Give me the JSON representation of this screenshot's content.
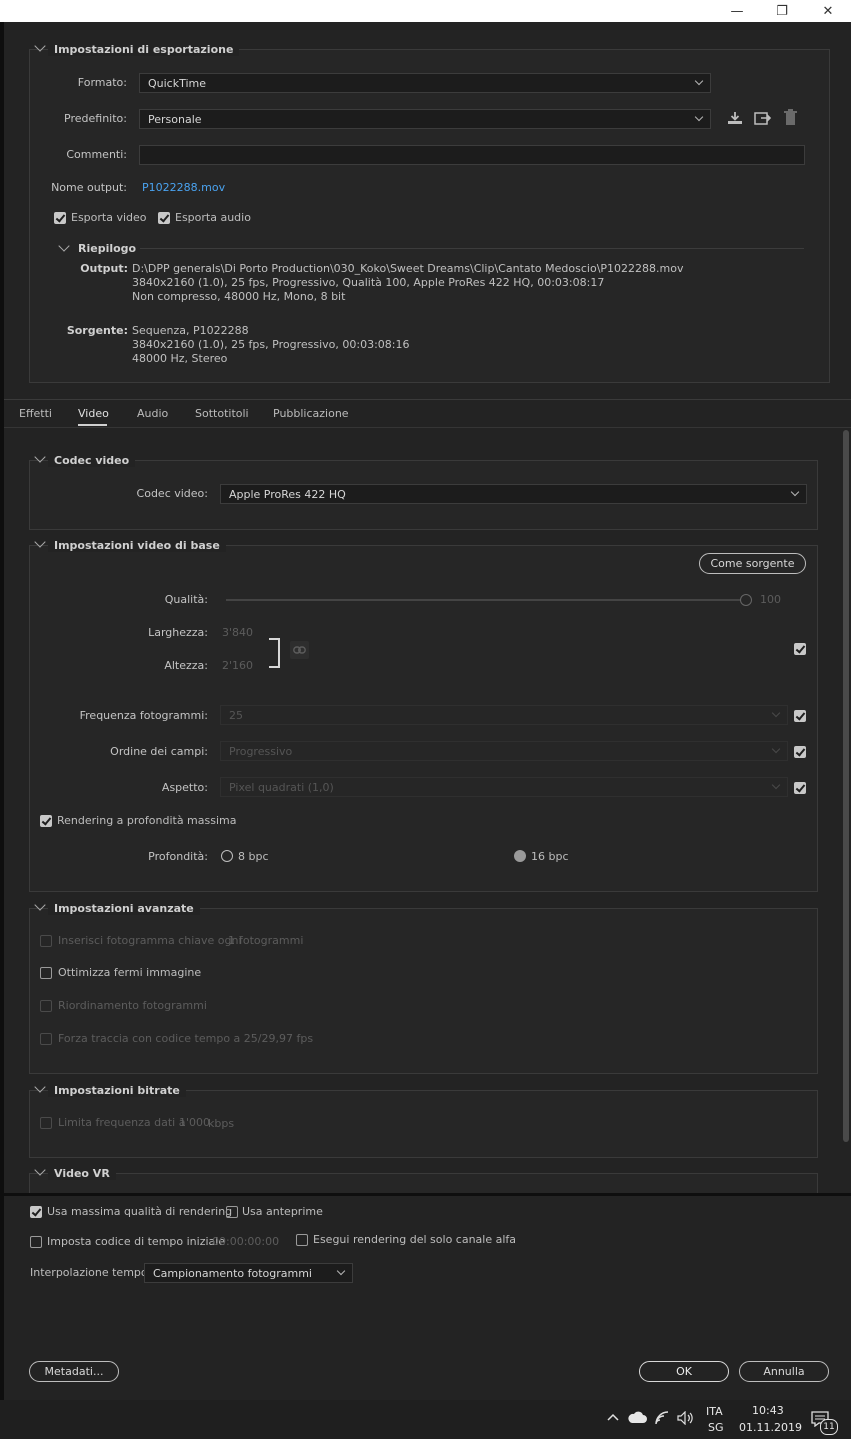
{
  "window": {
    "minimize": "—",
    "restore": "❐",
    "close": "✕"
  },
  "export_settings": {
    "title": "Impostazioni di esportazione",
    "format_label": "Formato:",
    "format_value": "QuickTime",
    "preset_label": "Predefinito:",
    "preset_value": "Personale",
    "comments_label": "Commenti:",
    "comments_value": "",
    "output_name_label": "Nome output:",
    "output_name_value": "P1022288.mov",
    "export_video_label": "Esporta video",
    "export_audio_label": "Esporta audio",
    "summary_title": "Riepilogo",
    "output_label": "Output:",
    "output_lines": [
      "D:\\DPP generals\\Di Porto Production\\030_Koko\\Sweet Dreams\\Clip\\Cantato Medoscio\\P1022288.mov",
      "3840x2160 (1.0), 25 fps, Progressivo, Qualità 100, Apple ProRes 422 HQ, 00:03:08:17",
      "Non compresso, 48000 Hz, Mono, 8 bit"
    ],
    "source_label": "Sorgente:",
    "source_lines": [
      "Sequenza, P1022288",
      "3840x2160 (1.0), 25 fps, Progressivo, 00:03:08:16",
      "48000 Hz, Stereo"
    ]
  },
  "tabs": [
    "Effetti",
    "Video",
    "Audio",
    "Sottotitoli",
    "Pubblicazione"
  ],
  "codec": {
    "title": "Codec video",
    "label": "Codec video:",
    "value": "Apple ProRes 422 HQ"
  },
  "basic": {
    "title": "Impostazioni video di base",
    "match_source": "Come sorgente",
    "quality_label": "Qualità:",
    "quality_value": "100",
    "quality_fraction": 1.0,
    "width_label": "Larghezza:",
    "width_value": "3'840",
    "height_label": "Altezza:",
    "height_value": "2'160",
    "fps_label": "Frequenza fotogrammi:",
    "fps_value": "25",
    "field_label": "Ordine dei campi:",
    "field_value": "Progressivo",
    "aspect_label": "Aspetto:",
    "aspect_value": "Pixel quadrati (1,0)",
    "max_depth_label": "Rendering a profondità massima",
    "depth_label": "Profondità:",
    "depth_8": "8 bpc",
    "depth_16": "16 bpc"
  },
  "advanced": {
    "title": "Impostazioni avanzate",
    "keyframe_label": "Inserisci fotogramma chiave ogni",
    "keyframe_value": "1",
    "keyframe_unit": "fotogrammi",
    "optimize_label": "Ottimizza fermi immagine",
    "reorder_label": "Riordinamento fotogrammi",
    "force_tc_label": "Forza traccia con codice tempo a 25/29,97 fps"
  },
  "bitrate": {
    "title": "Impostazioni bitrate",
    "limit_label": "Limita frequenza dati a",
    "limit_value": "1'000",
    "limit_unit": "kbps"
  },
  "vr": {
    "title": "Video VR"
  },
  "bottom": {
    "max_quality_label": "Usa massima qualità di rendering",
    "previews_label": "Usa anteprime",
    "set_tc_label": "Imposta codice di tempo iniziale",
    "tc_value": "00:00:00:00",
    "alpha_label": "Esegui rendering del solo canale alfa",
    "interp_label": "Interpolazione tempo:",
    "interp_value": "Campionamento fotogrammi",
    "metadata_btn": "Metadati...",
    "ok_btn": "OK",
    "cancel_btn": "Annulla"
  },
  "taskbar": {
    "lang1": "ITA",
    "lang2": "SG",
    "time": "10:43",
    "date": "01.11.2019",
    "notif_count": "11"
  },
  "colors": {
    "link": "#4aa3f0",
    "bg": "#232323"
  }
}
